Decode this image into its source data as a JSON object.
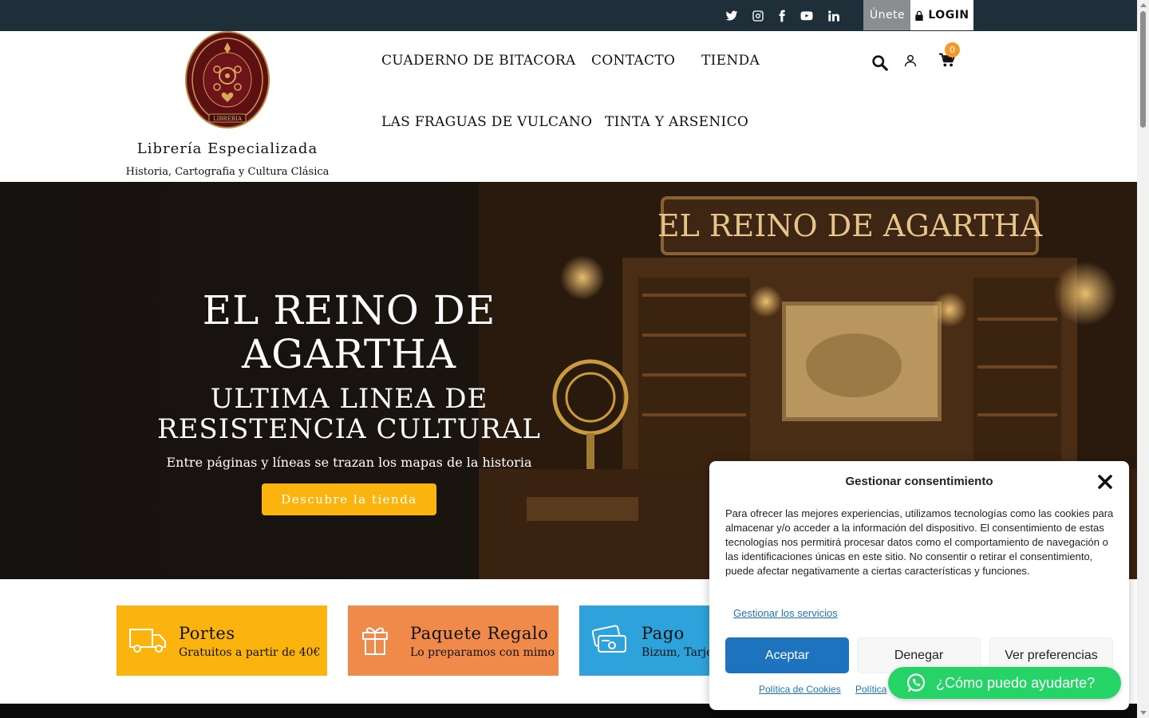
{
  "topbar": {
    "social_icons": [
      "twitter-icon",
      "instagram-icon",
      "facebook-icon",
      "youtube-icon",
      "linkedin-icon"
    ],
    "join_label": "Únete",
    "login_label": "LOGIN",
    "background": "#1f2f3a"
  },
  "header": {
    "logo_text": "LIBRERIA",
    "brand_title": "Librería Especializada",
    "brand_subtitle": "Historia, Cartografia y Cultura Clásica",
    "nav": [
      {
        "label": "CUADERNO DE BITACORA"
      },
      {
        "label": "CONTACTO"
      },
      {
        "label": "TIENDA"
      },
      {
        "label": "LAS FRAGUAS DE VULCANO"
      },
      {
        "label": "TINTA Y ARSENICO"
      }
    ],
    "icons": [
      "search-icon",
      "user-icon",
      "cart-icon"
    ],
    "cart_count": "0"
  },
  "hero": {
    "title": "EL REINO DE AGARTHA",
    "subtitle": "ULTIMA LINEA DE RESISTENCIA CULTURAL",
    "description": "Entre páginas y líneas se trazan los mapas de la historia",
    "button_label": "Descubre la tienda",
    "sign_text": "EL REINO DE AGARTHA",
    "accent": "#fbb30e"
  },
  "features": [
    {
      "title": "Portes",
      "subtitle": "Gratuitos a partir de 40€",
      "color": "#fbb30e",
      "icon": "truck-icon"
    },
    {
      "title": "Paquete Regalo",
      "subtitle": "Lo preparamos con mimo",
      "color": "#f08a4b",
      "icon": "gift-icon"
    },
    {
      "title": "Pago",
      "subtitle": "Bizum, Tarjeta",
      "color": "#2ea3db",
      "icon": "credit-card-icon"
    }
  ],
  "consent": {
    "title": "Gestionar consentimiento",
    "body": "Para ofrecer las mejores experiencias, utilizamos tecnologías como las cookies para almacenar y/o acceder a la información del dispositivo. El consentimiento de estas tecnologías nos permitirá procesar datos como el comportamiento de navegación o las identificaciones únicas en este sitio. No consentir o retirar el consentimiento, puede afectar negativamente a ciertas características y funciones.",
    "manage_link": "Gestionar los servicios",
    "accept_label": "Aceptar",
    "deny_label": "Denegar",
    "prefs_label": "Ver preferencias",
    "cookie_policy_link": "Política de Cookies",
    "privacy_link": "Política",
    "accent": "#1e73be"
  },
  "whatsapp": {
    "label": "¿Cómo puedo ayudarte?",
    "color": "#25d366"
  }
}
